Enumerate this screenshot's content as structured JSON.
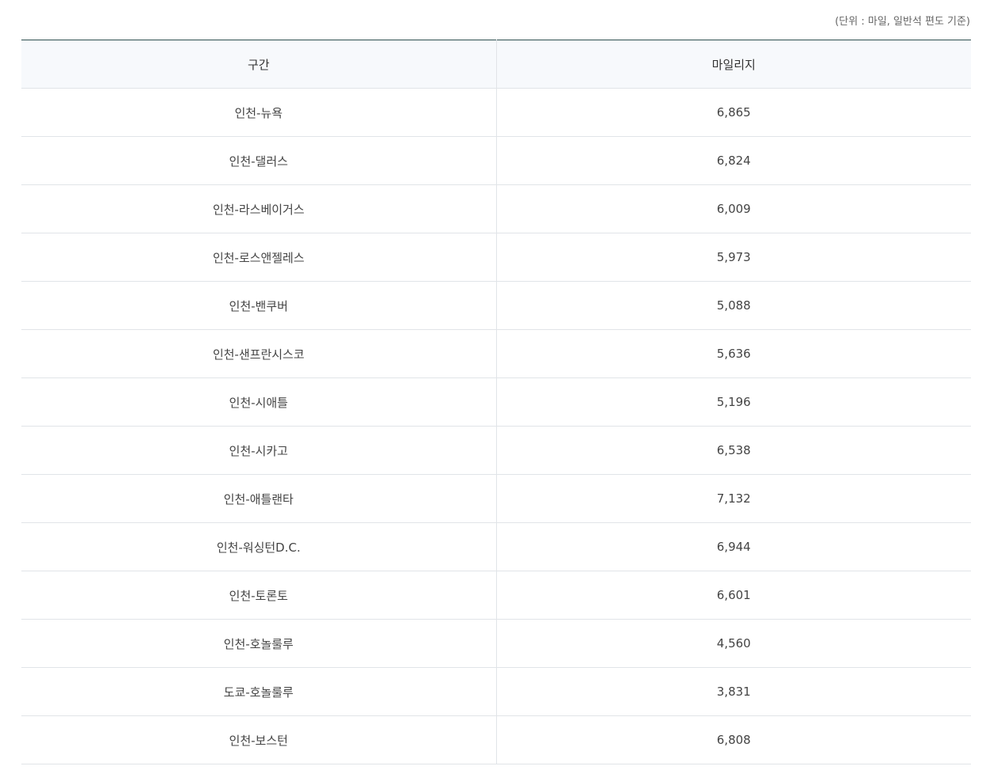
{
  "unit_note": "(단위 : 마일, 일반석 편도 기준)",
  "table": {
    "headers": [
      "구간",
      "마일리지"
    ],
    "rows": [
      [
        "인천-뉴욕",
        "6,865"
      ],
      [
        "인천-댈러스",
        "6,824"
      ],
      [
        "인천-라스베이거스",
        "6,009"
      ],
      [
        "인천-로스앤젤레스",
        "5,973"
      ],
      [
        "인천-밴쿠버",
        "5,088"
      ],
      [
        "인천-샌프란시스코",
        "5,636"
      ],
      [
        "인천-시애틀",
        "5,196"
      ],
      [
        "인천-시카고",
        "6,538"
      ],
      [
        "인천-애틀랜타",
        "7,132"
      ],
      [
        "인천-워싱턴D.C.",
        "6,944"
      ],
      [
        "인천-토론토",
        "6,601"
      ],
      [
        "인천-호놀룰루",
        "4,560"
      ],
      [
        "도쿄-호놀룰루",
        "3,831"
      ],
      [
        "인천-보스턴",
        "6,808"
      ]
    ]
  },
  "colors": {
    "header_bg": "#f7f9fc",
    "top_border": "#2f4f4f",
    "row_border": "#e1e4e8",
    "text": "#333333"
  }
}
